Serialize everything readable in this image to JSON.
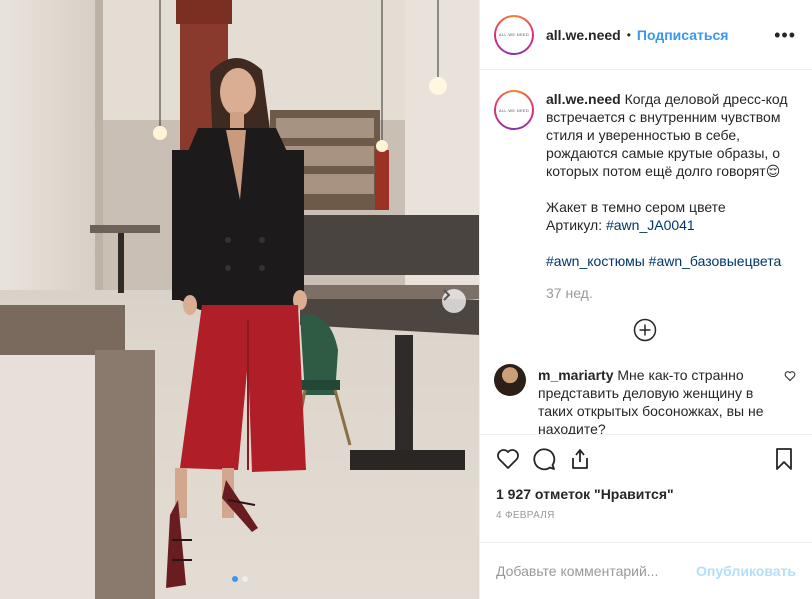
{
  "header": {
    "avatar_text": "ALL.WE.NEED",
    "username": "all.we.need",
    "separator": "•",
    "follow_label": "Подписаться",
    "more_label": "•••"
  },
  "caption": {
    "username": "all.we.need",
    "text": "Когда деловой дресс-код встречается с внутренним чувством стиля и уверенностью в себе, рождаются самые крутые образы, о которых потом ещё долго говорят",
    "emoji": "😌",
    "line2": "Жакет в темно сером цвете",
    "article_prefix": "Артикул: ",
    "article_tag": "#awn_JA0041",
    "tag1": "#awn_костюмы",
    "tag2": "#awn_базовыецвета",
    "time": "37 нед."
  },
  "comment": {
    "username": "m_mariarty",
    "text": "Мне как-то странно представить деловую женщину в таких открытых босоножках, вы не находите?"
  },
  "likes": "1 927 отметок \"Нравится\"",
  "date": "4 ФЕВРАЛЯ",
  "add_comment": {
    "placeholder": "Добавьте комментарий...",
    "publish_label": "Опубликовать"
  },
  "carousel": {
    "current": 1,
    "total": 2
  },
  "colors": {
    "accent": "#3897f0",
    "tag": "#003569",
    "publish_disabled": "#b2dffc"
  }
}
